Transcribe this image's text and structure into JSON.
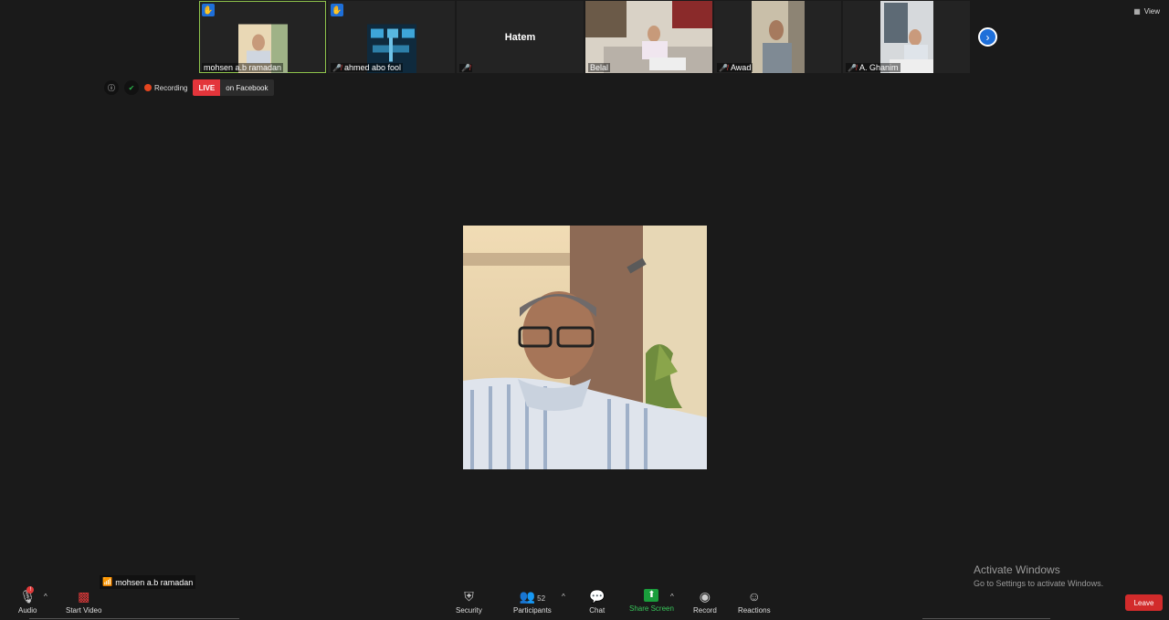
{
  "participants": [
    {
      "name": "mohsen a.b ramadan",
      "hand": true,
      "muted": false
    },
    {
      "name": "ahmed abo fool",
      "hand": true,
      "muted": true
    },
    {
      "name": "Hatem",
      "hand": false,
      "muted": true
    },
    {
      "name": "Belal",
      "hand": false,
      "muted": false
    },
    {
      "name": "Awad",
      "hand": false,
      "muted": true
    },
    {
      "name": "A. Ghanim",
      "hand": false,
      "muted": true
    }
  ],
  "view_label": "View",
  "status": {
    "recording_label": "Recording",
    "live_label": "LIVE",
    "live_target": "on Facebook"
  },
  "speaker_name": "mohsen a.b ramadan",
  "activate": {
    "title": "Activate Windows",
    "subtitle": "Go to Settings to activate Windows."
  },
  "toolbar": {
    "audio": "Audio",
    "audio_badge": "!",
    "start_video": "Start Video",
    "security": "Security",
    "participants": "Participants",
    "participants_count": "52",
    "chat": "Chat",
    "share_screen": "Share Screen",
    "record": "Record",
    "reactions": "Reactions",
    "leave": "Leave"
  },
  "colors": {
    "background": "#1a1a1a",
    "accent_blue": "#1e6fd9",
    "live_red": "#e3353b",
    "share_green": "#1a9e3c",
    "leave_red": "#d22b2b"
  }
}
